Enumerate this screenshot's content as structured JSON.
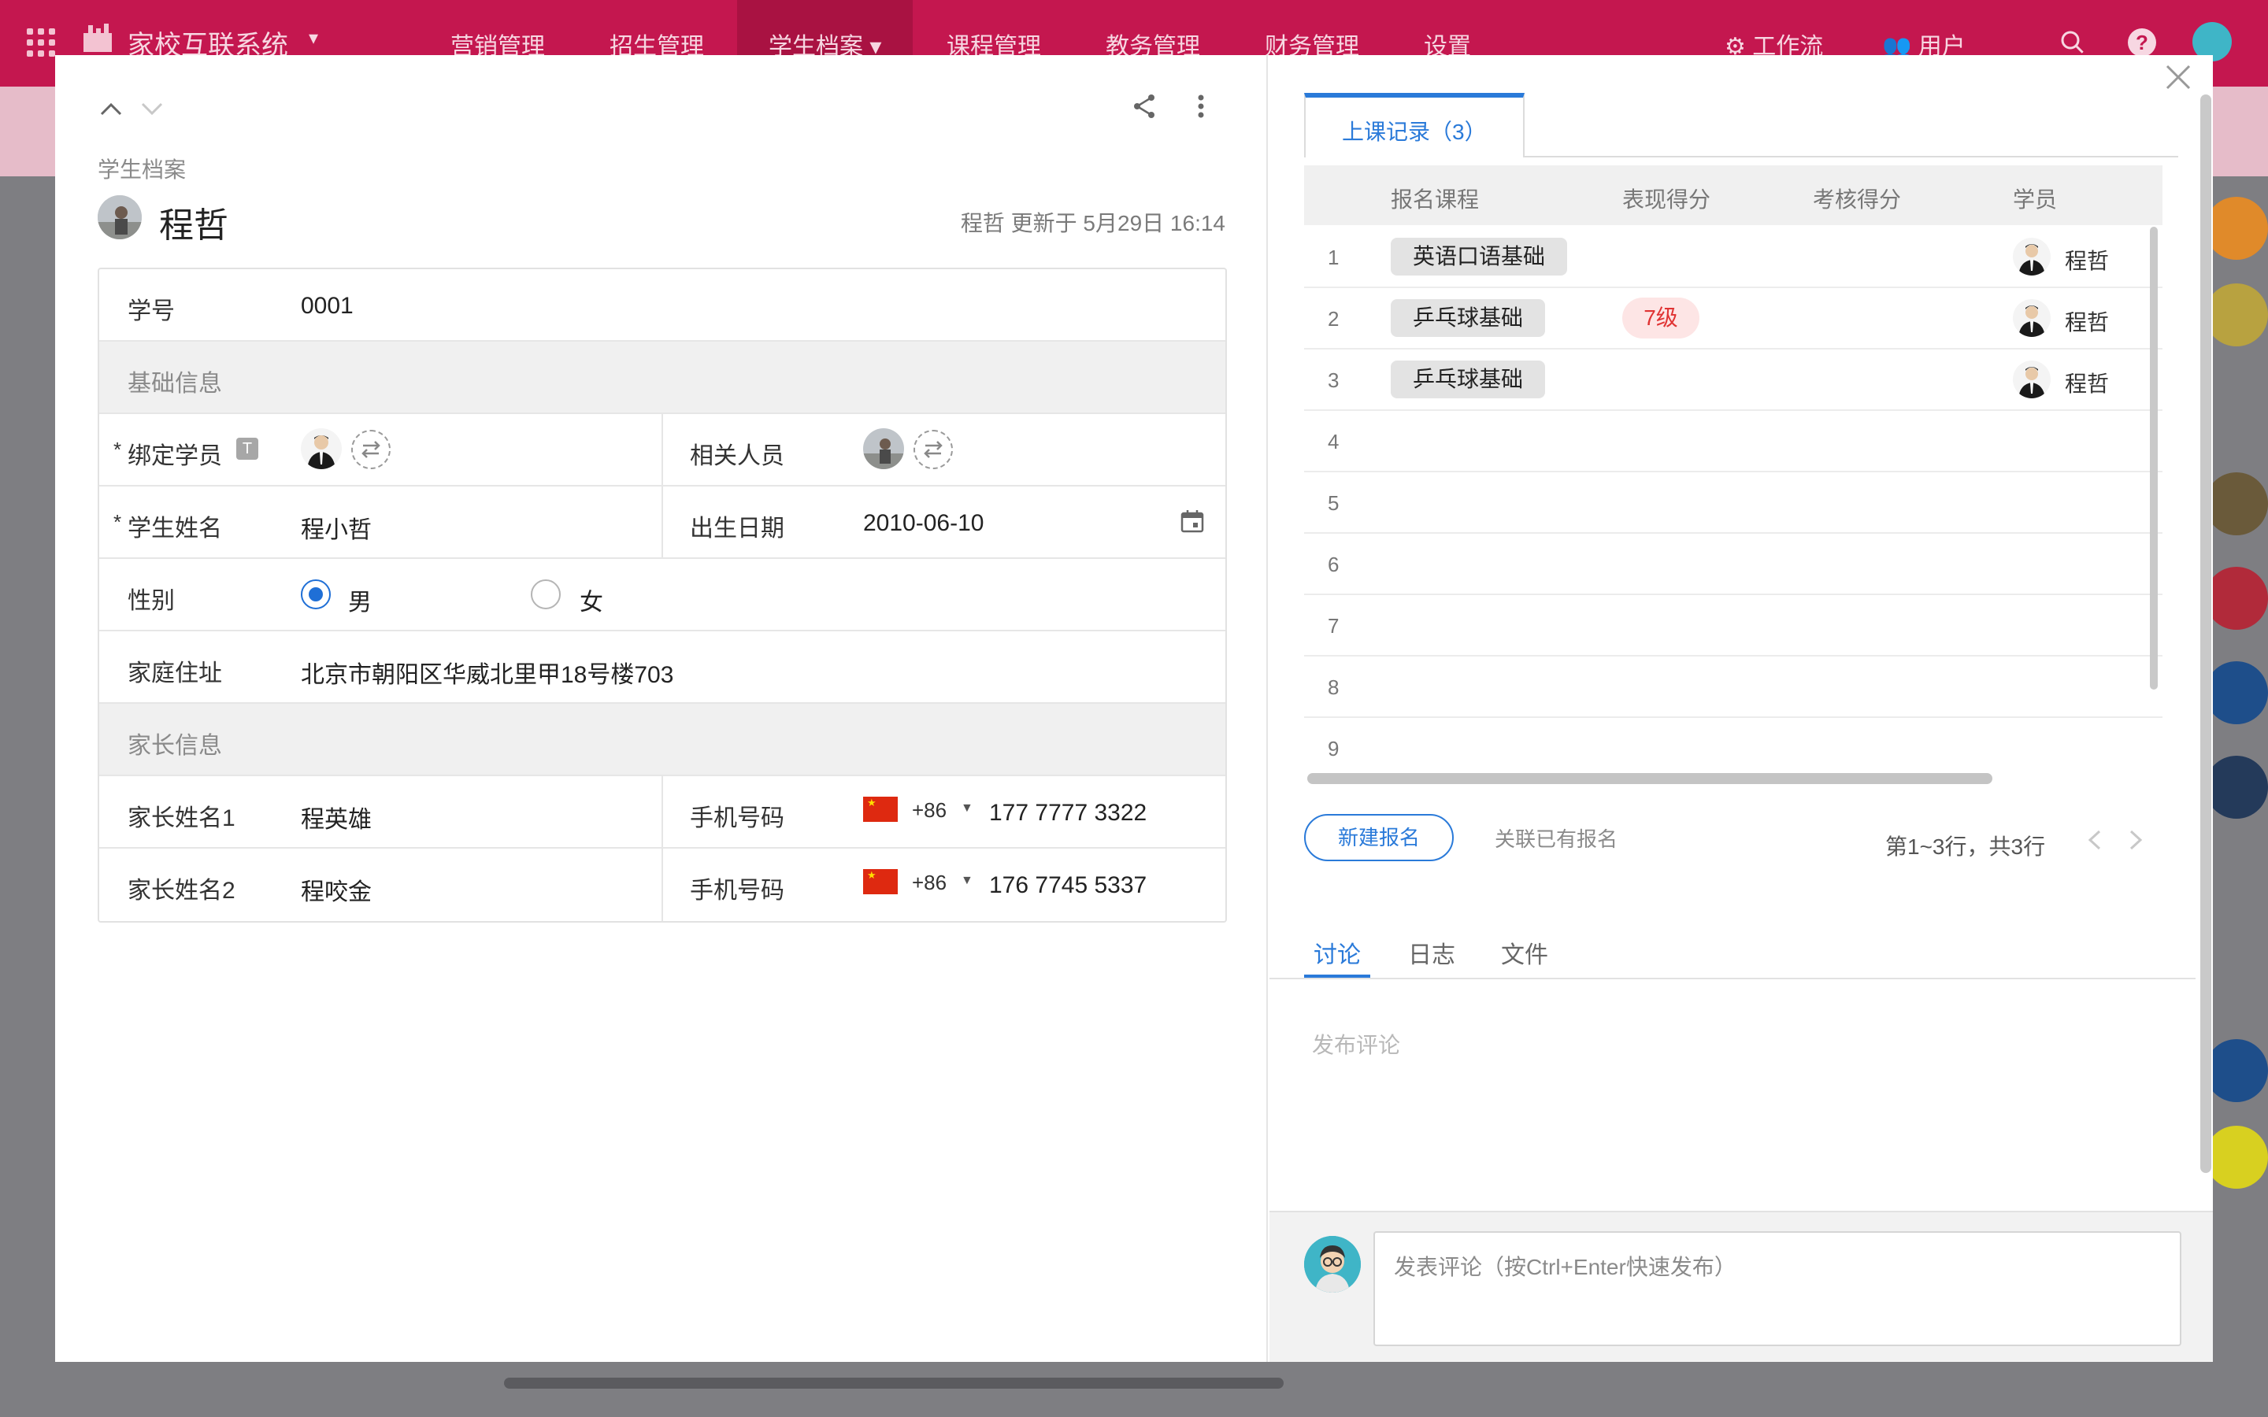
{
  "app": {
    "title": "家校互联系统",
    "nav": [
      "营销管理",
      "招生管理",
      "学生档案",
      "课程管理",
      "教务管理",
      "财务管理",
      "设置"
    ],
    "active_nav": "学生档案",
    "workflow_label": "工作流",
    "users_label": "用户",
    "brand_color": "#c4174f"
  },
  "record": {
    "breadcrumb": "学生档案",
    "title": "程哲",
    "updated": "程哲 更新于 5月29日 16:14"
  },
  "form": {
    "student_no_label": "学号",
    "student_no": "0001",
    "section_basic": "基础信息",
    "bind_label": "绑定学员",
    "t_badge": "T",
    "related_label": "相关人员",
    "name_label": "学生姓名",
    "name": "程小哲",
    "birth_label": "出生日期",
    "birth": "2010-06-10",
    "gender_label": "性别",
    "gender_male": "男",
    "gender_female": "女",
    "gender_selected": "男",
    "address_label": "家庭住址",
    "address": "北京市朝阳区华威北里甲18号楼703",
    "section_parent": "家长信息",
    "parent1_label": "家长姓名1",
    "parent1": "程英雄",
    "phone_label": "手机号码",
    "phone1_cc": "+86",
    "phone1": "177 7777 3322",
    "parent2_label": "家长姓名2",
    "parent2": "程咬金",
    "phone2_cc": "+86",
    "phone2": "176 7745 5337",
    "required_mark": "*"
  },
  "attendance": {
    "tab_label": "上课记录（3）",
    "columns": [
      "报名课程",
      "表现得分",
      "考核得分",
      "学员"
    ],
    "rows": [
      {
        "num": "1",
        "course": "英语口语基础",
        "score": "",
        "student": "程哲"
      },
      {
        "num": "2",
        "course": "乒乓球基础",
        "score": "7级",
        "student": "程哲"
      },
      {
        "num": "3",
        "course": "乒乓球基础",
        "score": "",
        "student": "程哲"
      },
      {
        "num": "4"
      },
      {
        "num": "5"
      },
      {
        "num": "6"
      },
      {
        "num": "7"
      },
      {
        "num": "8"
      },
      {
        "num": "9"
      }
    ],
    "new_button": "新建报名",
    "link_existing": "关联已有报名",
    "pager": "第1~3行，共3行"
  },
  "discussion": {
    "tabs": [
      "讨论",
      "日志",
      "文件"
    ],
    "active_tab": "讨论",
    "post_placeholder": "发布评论",
    "input_placeholder": "发表评论（按Ctrl+Enter快速发布）",
    "accent_color": "#2a7ad9"
  }
}
